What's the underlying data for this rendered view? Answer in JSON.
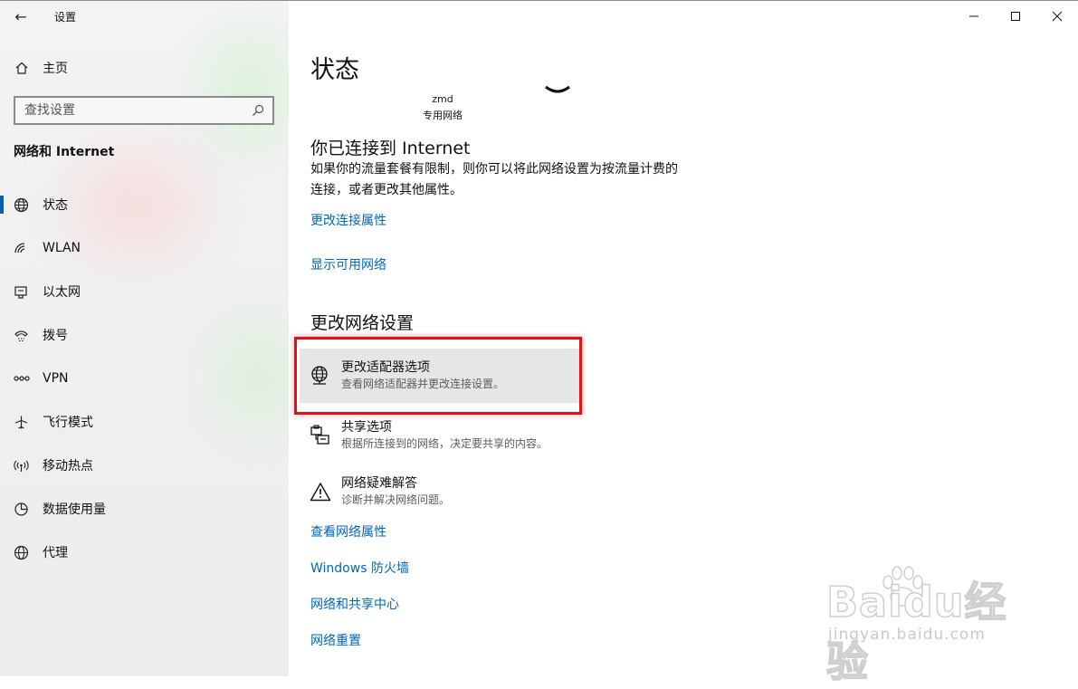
{
  "titlebar": {
    "back_label": "←",
    "app_title": "设置",
    "minimize": "—",
    "maximize": "☐",
    "close": "✕"
  },
  "sidebar": {
    "home_label": "主页",
    "search_placeholder": "查找设置",
    "section_heading": "网络和 Internet",
    "items": [
      {
        "label": "状态",
        "icon": "globe-status-icon",
        "active": true
      },
      {
        "label": "WLAN",
        "icon": "wifi-icon",
        "active": false
      },
      {
        "label": "以太网",
        "icon": "ethernet-icon",
        "active": false
      },
      {
        "label": "拨号",
        "icon": "dialup-icon",
        "active": false
      },
      {
        "label": "VPN",
        "icon": "vpn-icon",
        "active": false
      },
      {
        "label": "飞行模式",
        "icon": "airplane-icon",
        "active": false
      },
      {
        "label": "移动热点",
        "icon": "hotspot-icon",
        "active": false
      },
      {
        "label": "数据使用量",
        "icon": "data-usage-icon",
        "active": false
      },
      {
        "label": "代理",
        "icon": "proxy-globe-icon",
        "active": false
      }
    ]
  },
  "main": {
    "page_title": "状态",
    "network_name": "zmd",
    "network_type": "专用网络",
    "connected_title": "你已连接到 Internet",
    "connected_desc": "如果你的流量套餐有限制，则你可以将此网络设置为按流量计费的连接，或者更改其他属性。",
    "link_change_props": "更改连接属性",
    "link_show_networks": "显示可用网络",
    "change_settings_title": "更改网络设置",
    "settings": [
      {
        "title": "更改适配器选项",
        "desc": "查看网络适配器并更改连接设置。",
        "icon": "adapter-globe-icon"
      },
      {
        "title": "共享选项",
        "desc": "根据所连接到的网络，决定要共享的内容。",
        "icon": "sharing-icon"
      },
      {
        "title": "网络疑难解答",
        "desc": "诊断并解决网络问题。",
        "icon": "warning-icon"
      }
    ],
    "links_bottom": [
      "查看网络属性",
      "Windows 防火墙",
      "网络和共享中心",
      "网络重置"
    ]
  },
  "watermark": {
    "main": "Baidu经验",
    "sub": "jingyan.baidu.com"
  },
  "colors": {
    "accent": "#0063b1",
    "link": "#0067b8",
    "highlight": "#d8151b"
  }
}
